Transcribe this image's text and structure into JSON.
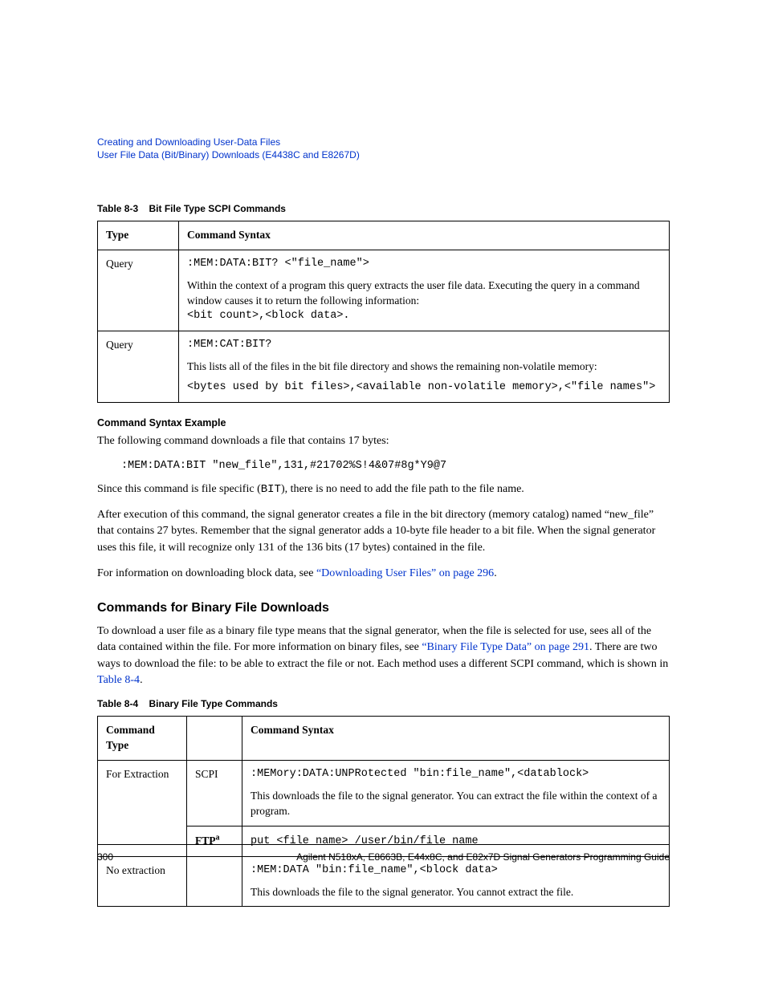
{
  "header": {
    "line1": "Creating and Downloading User-Data Files",
    "line2": "User File Data (Bit/Binary) Downloads (E4438C and E8267D)"
  },
  "table83": {
    "caption_num": "Table 8-3",
    "caption_title": "Bit File Type SCPI Commands",
    "head": {
      "type": "Type",
      "syntax": "Command Syntax"
    },
    "rows": [
      {
        "type": "Query",
        "cmd": ":MEM:DATA:BIT? <\"file_name\">",
        "desc": "Within the context of a program this query extracts the user file data. Executing the query in a command window causes it to return the following information:",
        "ret": "<bit count>,<block data>."
      },
      {
        "type": "Query",
        "cmd": ":MEM:CAT:BIT?",
        "desc": "This lists all of the files in the bit file directory and shows the remaining non-volatile memory:",
        "ret": "<bytes used by bit files>,<available non-volatile memory>,<\"file names\">"
      }
    ]
  },
  "example": {
    "heading": "Command Syntax Example",
    "p1": "The following command downloads a file that contains 17 bytes:",
    "code": ":MEM:DATA:BIT \"new_file\",131,#21702%S!4&07#8g*Y9@7",
    "p2a": "Since this command is file specific (",
    "p2b": "BIT",
    "p2c": "), there is no need to add the file path to the file name.",
    "p3": "After execution of this command, the signal generator creates a file in the bit directory (memory catalog) named “new_file” that contains 27 bytes. Remember that the signal generator adds a 10-byte file header to a bit file. When the signal generator uses this file, it will recognize only 131 of the 136 bits (17 bytes) contained in the file.",
    "p4a": "For information on downloading block data, see ",
    "p4link": "“Downloading User Files” on page 296",
    "p4b": "."
  },
  "binary": {
    "heading": "Commands for Binary File Downloads",
    "p1a": "To download a user file as a binary file type means that the signal generator, when the file is selected for use, sees all of the data contained within the file. For more information on binary files, see ",
    "p1link": "“Binary File Type Data” on page 291",
    "p1b": ". There are two ways to download the file: to be able to extract the file or not. Each method uses a different SCPI command, which is shown in ",
    "p1link2": "Table 8-4",
    "p1c": "."
  },
  "table84": {
    "caption_num": "Table 8-4",
    "caption_title": "Binary File Type Commands",
    "head": {
      "type": "Command Type",
      "blank": "",
      "syntax": "Command Syntax"
    },
    "rows": [
      {
        "type": "For Extraction",
        "proto": "SCPI",
        "cmd": ":MEMory:DATA:UNPRotected \"bin:file_name\",<datablock>",
        "desc": "This downloads the file to the signal generator. You can extract the file within the context of a program."
      },
      {
        "proto_html": "FTP",
        "proto_sup": "a",
        "cmd": "put <file_name> /user/bin/file_name"
      },
      {
        "type": "No extraction",
        "proto": "",
        "cmd": ":MEM:DATA \"bin:file_name\",<block data>",
        "desc": "This downloads the file to the signal generator. You cannot extract the file."
      }
    ]
  },
  "footer": {
    "page": "300",
    "title": "Agilent N518xA, E8663B, E44x8C, and E82x7D Signal Generators Programming Guide"
  }
}
